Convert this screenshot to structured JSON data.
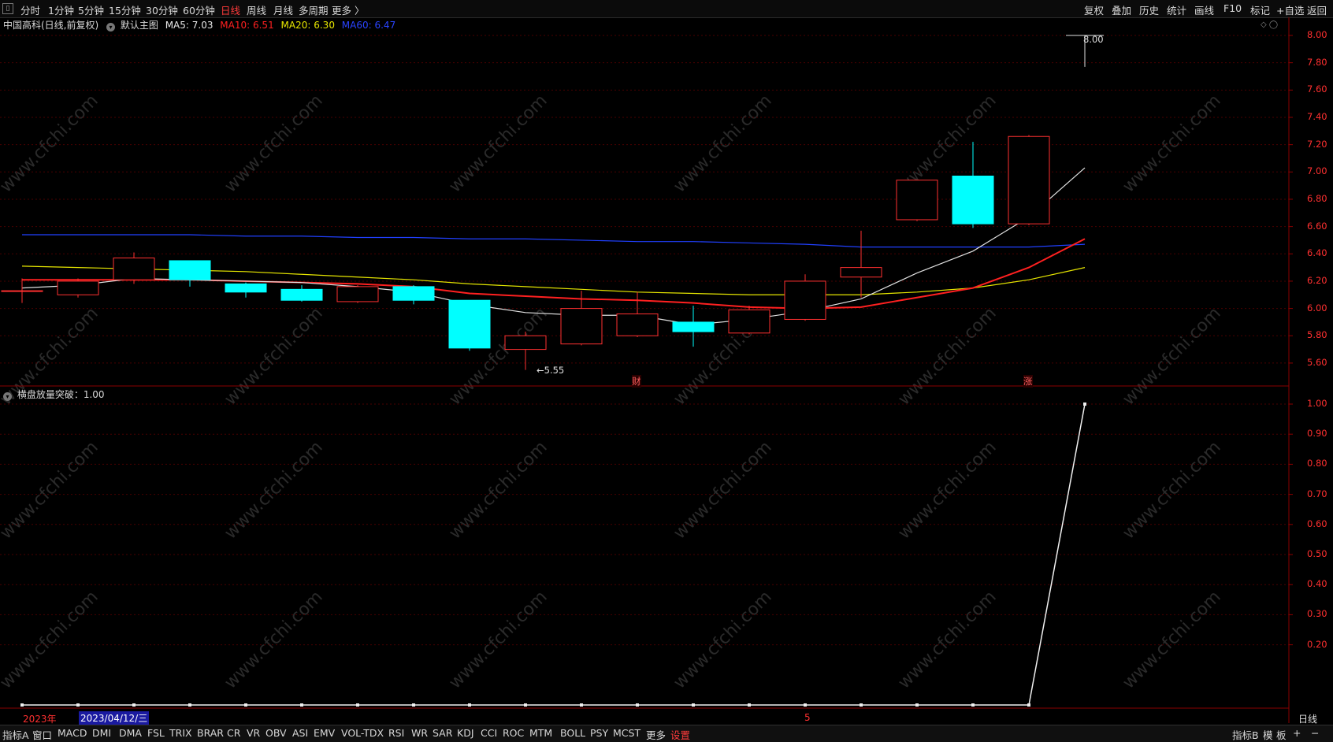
{
  "toolbar": {
    "left_tabs": [
      "分时",
      "1分钟",
      "5分钟",
      "15分钟",
      "30分钟",
      "60分钟",
      "日线",
      "周线",
      "月线",
      "多周期",
      "更多 〉"
    ],
    "active_tab": "日线",
    "right_buttons": [
      "复权",
      "叠加",
      "历史",
      "统计",
      "画线",
      "F10",
      "标记",
      "+自选",
      "返回"
    ]
  },
  "main_legend": {
    "stock": "中国高科(日线,前复权)",
    "template": "默认主图",
    "ma5": "MA5: 7.03",
    "ma10": "MA10: 6.51",
    "ma20": "MA20: 6.30",
    "ma60": "MA60: 6.47"
  },
  "indicator_legend": "横盘放量突破：1.00",
  "annotations": {
    "high_label": "8.00",
    "low_label": "5.55",
    "event_cai": "财",
    "event_zhang": "涨"
  },
  "x_axis": {
    "year": "2023年",
    "cursor_date": "2023/04/12/三",
    "month": "5",
    "period": "日线"
  },
  "colors": {
    "up": "#ff3030",
    "down": "#00ffff",
    "ma5": "#e0e0e0",
    "ma10": "#ff2020",
    "ma20": "#e6e600",
    "ma60": "#2040ff",
    "grid": "#5a0000"
  },
  "chart_data": [
    {
      "type": "candlestick",
      "title": "中国高科(日线,前复权)",
      "ylim": [
        5.5,
        8.1
      ],
      "yticks": [
        "8.00",
        "7.80",
        "7.60",
        "7.40",
        "7.20",
        "7.00",
        "6.80",
        "6.60",
        "6.40",
        "6.20",
        "6.00",
        "5.80",
        "5.60"
      ],
      "candles": [
        {
          "o": 6.13,
          "c": 6.13,
          "h": 6.22,
          "l": 6.04
        },
        {
          "o": 6.1,
          "c": 6.2,
          "h": 6.22,
          "l": 6.08
        },
        {
          "o": 6.21,
          "c": 6.37,
          "h": 6.41,
          "l": 6.18
        },
        {
          "o": 6.35,
          "c": 6.21,
          "h": 6.35,
          "l": 6.16
        },
        {
          "o": 6.18,
          "c": 6.12,
          "h": 6.19,
          "l": 6.08
        },
        {
          "o": 6.14,
          "c": 6.06,
          "h": 6.17,
          "l": 6.05
        },
        {
          "o": 6.05,
          "c": 6.16,
          "h": 6.17,
          "l": 6.04
        },
        {
          "o": 6.16,
          "c": 6.06,
          "h": 6.17,
          "l": 6.03
        },
        {
          "o": 6.06,
          "c": 5.71,
          "h": 6.06,
          "l": 5.69
        },
        {
          "o": 5.7,
          "c": 5.8,
          "h": 5.83,
          "l": 5.55
        },
        {
          "o": 5.74,
          "c": 6.0,
          "h": 6.13,
          "l": 5.73
        },
        {
          "o": 5.8,
          "c": 5.96,
          "h": 6.12,
          "l": 5.79
        },
        {
          "o": 5.9,
          "c": 5.83,
          "h": 6.02,
          "l": 5.72
        },
        {
          "o": 5.82,
          "c": 5.99,
          "h": 6.02,
          "l": 5.81
        },
        {
          "o": 5.92,
          "c": 6.2,
          "h": 6.25,
          "l": 5.91
        },
        {
          "o": 6.23,
          "c": 6.3,
          "h": 6.57,
          "l": 6.08
        },
        {
          "o": 6.65,
          "c": 6.94,
          "h": 6.94,
          "l": 6.64
        },
        {
          "o": 6.97,
          "c": 6.62,
          "h": 7.22,
          "l": 6.59
        },
        {
          "o": 6.62,
          "c": 7.26,
          "h": 7.27,
          "l": 6.61
        },
        {
          "o": 8.0,
          "c": 8.0,
          "h": 8.0,
          "l": 7.77
        }
      ],
      "ma5": [
        6.15,
        6.17,
        6.22,
        6.21,
        6.2,
        6.19,
        6.16,
        6.12,
        6.03,
        5.97,
        5.95,
        5.95,
        5.88,
        5.92,
        5.98,
        6.07,
        6.26,
        6.42,
        6.67,
        7.03
      ],
      "ma10": [
        6.21,
        6.21,
        6.21,
        6.21,
        6.2,
        6.19,
        6.18,
        6.16,
        6.11,
        6.09,
        6.07,
        6.06,
        6.04,
        6.01,
        6.0,
        6.01,
        6.08,
        6.15,
        6.3,
        6.51
      ],
      "ma20": [
        6.31,
        6.3,
        6.29,
        6.28,
        6.27,
        6.25,
        6.23,
        6.21,
        6.18,
        6.16,
        6.14,
        6.12,
        6.11,
        6.1,
        6.1,
        6.1,
        6.12,
        6.15,
        6.21,
        6.3
      ],
      "ma60": [
        6.54,
        6.54,
        6.54,
        6.54,
        6.53,
        6.53,
        6.52,
        6.52,
        6.51,
        6.51,
        6.5,
        6.49,
        6.49,
        6.48,
        6.47,
        6.45,
        6.45,
        6.45,
        6.45,
        6.47
      ]
    },
    {
      "type": "line",
      "title": "横盘放量突破",
      "ylim": [
        0,
        1.05
      ],
      "yticks": [
        "1.00",
        "0.90",
        "0.80",
        "0.70",
        "0.60",
        "0.50",
        "0.40",
        "0.30",
        "0.20"
      ],
      "values": [
        0,
        0,
        0,
        0,
        0,
        0,
        0,
        0,
        0,
        0,
        0,
        0,
        0,
        0,
        0,
        0,
        0,
        0,
        0,
        1.0
      ]
    }
  ]
}
